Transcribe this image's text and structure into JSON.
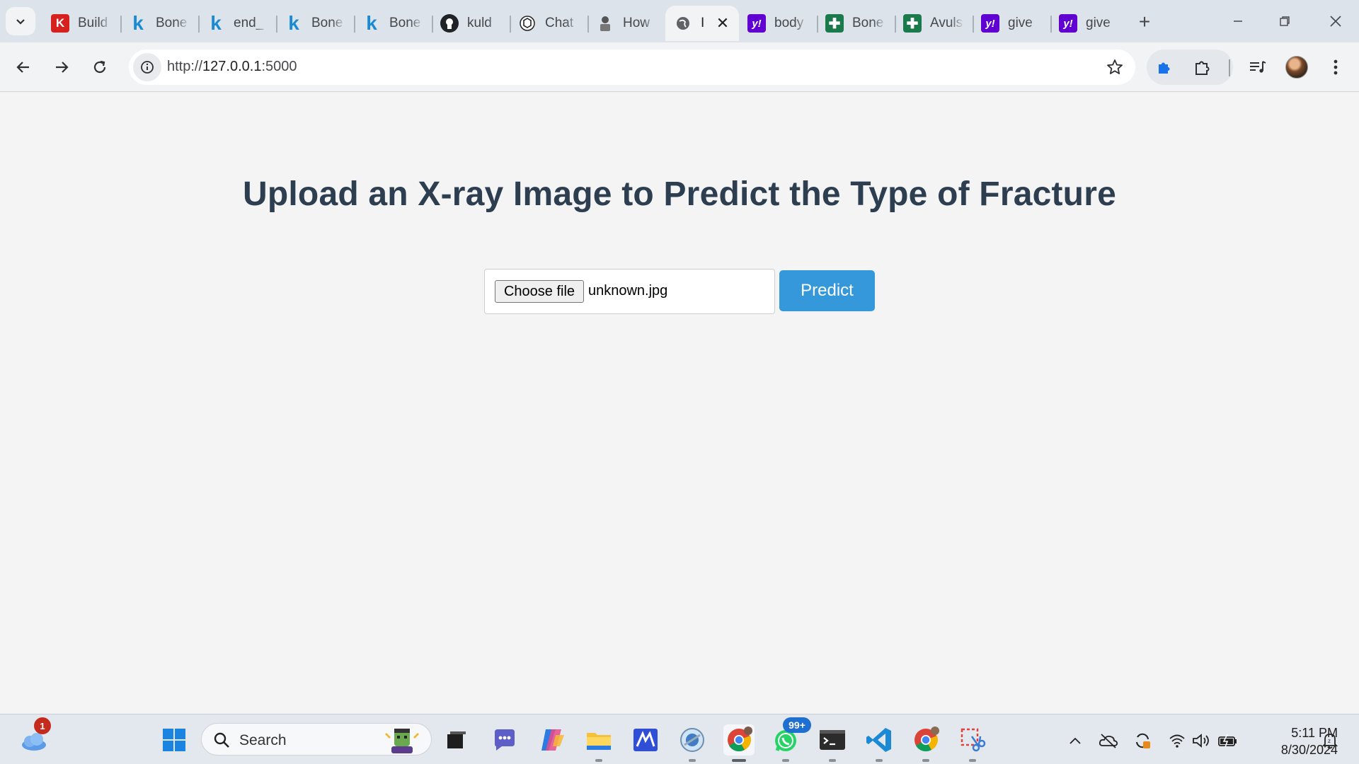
{
  "tabs": [
    {
      "title": "Build",
      "favicon": "k-red-icon"
    },
    {
      "title": "Bone",
      "favicon": "k-blue-icon"
    },
    {
      "title": "end_",
      "favicon": "k-blue-icon"
    },
    {
      "title": "Bone",
      "favicon": "k-blue-icon"
    },
    {
      "title": "Bone",
      "favicon": "k-blue-icon"
    },
    {
      "title": "kuld",
      "favicon": "github-icon"
    },
    {
      "title": "Chat",
      "favicon": "chatgpt-icon"
    },
    {
      "title": "How",
      "favicon": "person-icon"
    },
    {
      "title": "I",
      "favicon": "globe-icon",
      "active": true
    },
    {
      "title": "body",
      "favicon": "yahoo-icon"
    },
    {
      "title": "Bone",
      "favicon": "medical-cross-icon"
    },
    {
      "title": "Avuls",
      "favicon": "medical-cross-icon"
    },
    {
      "title": "give",
      "favicon": "yahoo-icon"
    },
    {
      "title": "give",
      "favicon": "yahoo-icon"
    }
  ],
  "address_bar": {
    "scheme": "http://",
    "host": "127.0.0.1",
    "port": ":5000"
  },
  "page": {
    "heading": "Upload an X-ray Image to Predict the Type of Fracture",
    "choose_file_label": "Choose file",
    "file_name": "unknown.jpg",
    "predict_label": "Predict"
  },
  "taskbar": {
    "search_label": "Search",
    "weather_badge": "1",
    "whatsapp_badge": "99+",
    "time": "5:11 PM",
    "date": "8/30/2024"
  },
  "colors": {
    "heading": "#2c3e50",
    "predict_button": "#3498db",
    "page_background": "#f4f4f4"
  }
}
